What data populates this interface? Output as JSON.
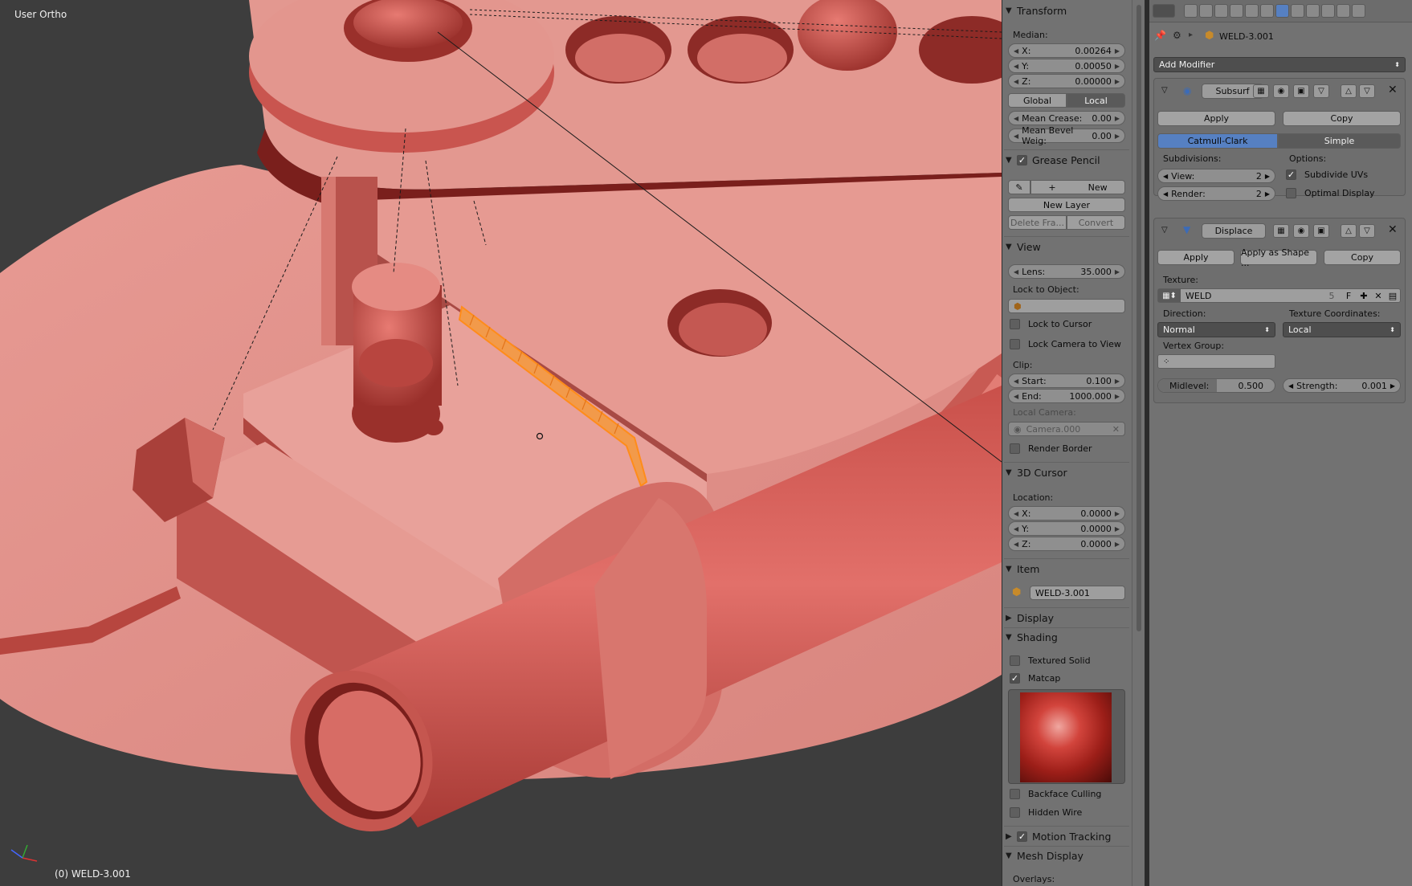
{
  "viewport": {
    "title": "User Ortho",
    "object_label": "(0) WELD-3.001"
  },
  "npanel": {
    "transform": {
      "header": "Transform",
      "median_label": "Median:",
      "x_label": "X:",
      "x_value": "0.00264",
      "y_label": "Y:",
      "y_value": "0.00050",
      "z_label": "Z:",
      "z_value": "0.00000",
      "global_label": "Global",
      "local_label": "Local",
      "mean_crease_label": "Mean Crease:",
      "mean_crease_value": "0.00",
      "mean_bevel_label": "Mean Bevel Weig:",
      "mean_bevel_value": "0.00"
    },
    "grease_pencil": {
      "header": "Grease Pencil",
      "new_label": "New",
      "new_layer_label": "New Layer",
      "delete_frame_label": "Delete Fra...",
      "convert_label": "Convert"
    },
    "view": {
      "header": "View",
      "lens_label": "Lens:",
      "lens_value": "35.000",
      "lock_to_object_label": "Lock to Object:",
      "lock_to_cursor_label": "Lock to Cursor",
      "lock_camera_label": "Lock Camera to View",
      "clip_label": "Clip:",
      "start_label": "Start:",
      "start_value": "0.100",
      "end_label": "End:",
      "end_value": "1000.000",
      "local_camera_label": "Local Camera:",
      "camera_value": "Camera.000",
      "render_border_label": "Render Border"
    },
    "cursor": {
      "header": "3D Cursor",
      "location_label": "Location:",
      "x_label": "X:",
      "x_value": "0.0000",
      "y_label": "Y:",
      "y_value": "0.0000",
      "z_label": "Z:",
      "z_value": "0.0000"
    },
    "item": {
      "header": "Item",
      "name": "WELD-3.001"
    },
    "display": {
      "header": "Display"
    },
    "shading": {
      "header": "Shading",
      "textured_solid_label": "Textured Solid",
      "matcap_label": "Matcap",
      "backface_culling_label": "Backface Culling",
      "hidden_wire_label": "Hidden Wire"
    },
    "motion_tracking": {
      "header": "Motion Tracking"
    },
    "mesh_display": {
      "header": "Mesh Display",
      "overlays_label": "Overlays:"
    }
  },
  "properties": {
    "object_name": "WELD-3.001",
    "add_modifier_label": "Add Modifier",
    "subsurf": {
      "name": "Subsurf",
      "apply_label": "Apply",
      "copy_label": "Copy",
      "catmull_clark_label": "Catmull-Clark",
      "simple_label": "Simple",
      "subdivisions_label": "Subdivisions:",
      "options_label": "Options:",
      "view_label": "View:",
      "view_value": "2",
      "render_label": "Render:",
      "render_value": "2",
      "subdivide_uvs_label": "Subdivide UVs",
      "optimal_display_label": "Optimal Display"
    },
    "displace": {
      "name": "Displace",
      "apply_label": "Apply",
      "apply_as_shape_label": "Apply as Shape ...",
      "copy_label": "Copy",
      "texture_label": "Texture:",
      "texture_name": "WELD",
      "texture_users": "5",
      "texture_fake": "F",
      "direction_label": "Direction:",
      "direction_value": "Normal",
      "tex_coords_label": "Texture Coordinates:",
      "tex_coords_value": "Local",
      "vertex_group_label": "Vertex Group:",
      "midlevel_label": "Midlevel:",
      "midlevel_value": "0.500",
      "strength_label": "Strength:",
      "strength_value": "0.001"
    }
  },
  "colors": {
    "mesh": "#e0918a",
    "mesh_dark": "#8a2e2a",
    "selection": "#ff8c1a",
    "accent_blue": "#5680c2"
  }
}
